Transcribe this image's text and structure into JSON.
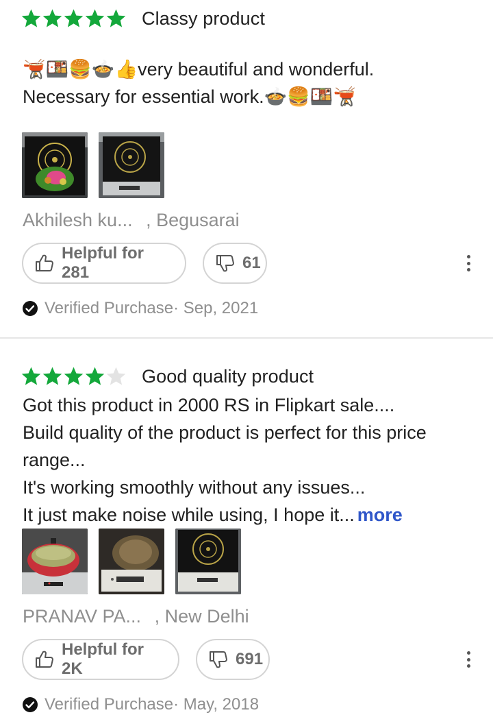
{
  "reviews": [
    {
      "rating": 5,
      "max_rating": 5,
      "title": "Classy product",
      "text_lines": [
        "🫕🍱🍔🍲👍very beautiful and wonderful.",
        "Necessary for essential work.🍲🍔🍱🫕"
      ],
      "photo_count": 2,
      "author_name": "Akhilesh ku...",
      "author_location": ", Begusarai",
      "helpful_label": "Helpful for 281",
      "dislike_count": "61",
      "verified_label": "Verified Purchase",
      "date": "· Sep, 2021"
    },
    {
      "rating": 4,
      "max_rating": 5,
      "title": "Good quality product",
      "text_lines": [
        "Got this product in 2000 RS in Flipkart sale....",
        "Build quality of the product is perfect for this price",
        "range...",
        "It's working smoothly without any issues...",
        "It just make noise  while using, I hope  it..."
      ],
      "more_label": "more",
      "photo_count": 3,
      "author_name": "PRANAV PA...",
      "author_location": ", New Delhi",
      "helpful_label": "Helpful for 2K",
      "dislike_count": "691",
      "verified_label": "Verified Purchase",
      "date": "· May, 2018"
    }
  ],
  "icons": {
    "star_filled": "star-icon",
    "star_empty": "star-outline-icon",
    "thumbs_up": "thumbs-up-icon",
    "thumbs_down": "thumbs-down-icon",
    "verified": "check-circle-icon",
    "menu": "more-vertical-icon"
  },
  "colors": {
    "star_filled": "#14a83b",
    "star_empty": "#e3e3e3",
    "link": "#2f56c9",
    "muted_text": "#8f8f8f",
    "body_text": "#212121"
  }
}
